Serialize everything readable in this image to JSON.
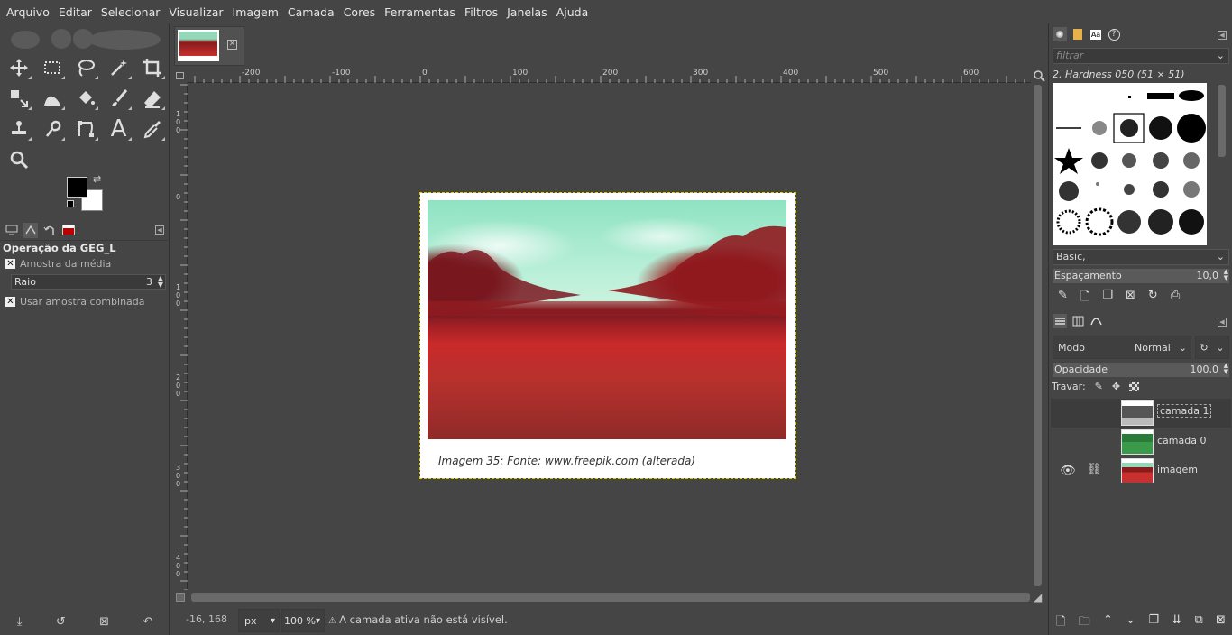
{
  "menubar": [
    "Arquivo",
    "Editar",
    "Selecionar",
    "Visualizar",
    "Imagem",
    "Camada",
    "Cores",
    "Ferramentas",
    "Filtros",
    "Janelas",
    "Ajuda"
  ],
  "toolbox": {
    "tools": [
      {
        "name": "move-tool-icon"
      },
      {
        "name": "rect-select-icon"
      },
      {
        "name": "free-select-icon"
      },
      {
        "name": "fuzzy-select-icon"
      },
      {
        "name": "crop-icon"
      },
      {
        "name": "unified-transform-icon"
      },
      {
        "name": "warp-transform-icon"
      },
      {
        "name": "bucket-fill-icon"
      },
      {
        "name": "paintbrush-icon"
      },
      {
        "name": "eraser-icon"
      },
      {
        "name": "clone-icon"
      },
      {
        "name": "smudge-icon"
      },
      {
        "name": "paths-icon"
      },
      {
        "name": "text-tool-icon"
      },
      {
        "name": "color-picker-icon"
      },
      {
        "name": "zoom-icon"
      }
    ],
    "text_tool_glyph": "A",
    "fg_color": "#000000",
    "bg_color": "#ffffff"
  },
  "tool_options": {
    "title": "Operação da GEG_L",
    "sample_average_label": "Amostra da média",
    "radius_label": "Raio",
    "radius_value": "3",
    "sample_merged_label": "Usar amostra combinada"
  },
  "canvas": {
    "ruler_h_ticks": [
      "-200",
      "-100",
      "0",
      "100",
      "200",
      "300",
      "400",
      "500",
      "600"
    ],
    "ruler_v_ticks": [
      "1\n0\n0",
      "0",
      "1\n0\n0",
      "2\n0\n0",
      "3\n0\n0",
      "4\n0\n0"
    ],
    "caption": "Imagem 35: Fonte: www.freepik.com (alterada)"
  },
  "statusbar": {
    "coords": "-16, 168",
    "unit": "px",
    "zoom": "100 %",
    "message": "A camada ativa não está visível."
  },
  "brushes": {
    "filter_placeholder": "filtrar",
    "current_brush": "2. Hardness 050 (51 × 51)",
    "tag_combo": "Basic,",
    "spacing_label": "Espaçamento",
    "spacing_value": "10,0"
  },
  "layers": {
    "mode_label": "Modo",
    "mode_value": "Normal",
    "opacity_label": "Opacidade",
    "opacity_value": "100,0",
    "lock_label": "Travar:",
    "items": [
      {
        "name": "camada 1",
        "selected": true,
        "visible": false
      },
      {
        "name": "camada 0",
        "selected": false,
        "visible": false
      },
      {
        "name": "imagem",
        "selected": false,
        "visible": true
      }
    ]
  }
}
